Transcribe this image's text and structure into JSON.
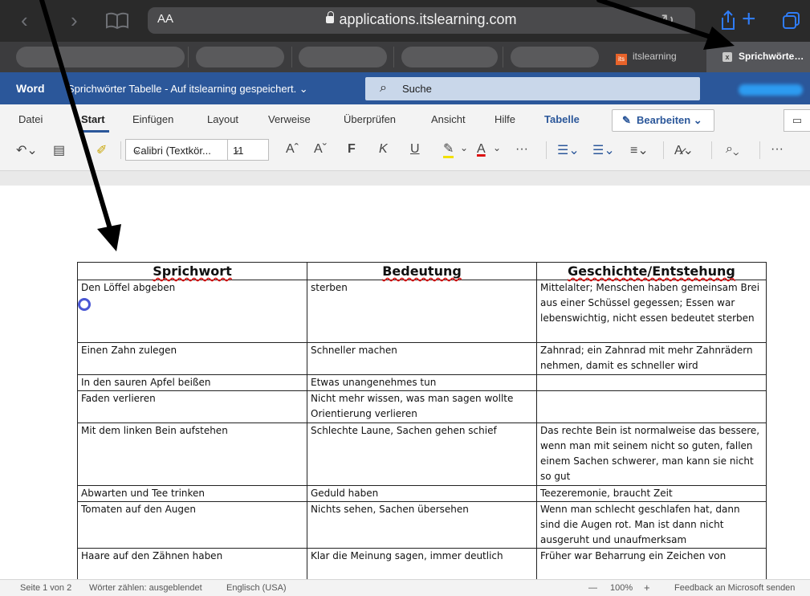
{
  "browser": {
    "text_size_label": "AA",
    "url": "applications.itslearning.com",
    "tabs": [
      {
        "label": "itslearning",
        "logo_text": "its"
      },
      {
        "label": "Sprichwörte…",
        "close_glyph": "x"
      }
    ]
  },
  "word": {
    "app_name": "Word",
    "doc_title": "Sprichwörter Tabelle - Auf itslearning gespeichert. ⌄",
    "search_placeholder": "Suche",
    "accent_color": "#2b579a"
  },
  "ribbon": {
    "menu": [
      "Datei",
      "Start",
      "Einfügen",
      "Layout",
      "Verweise",
      "Überprüfen",
      "Ansicht",
      "Hilfe",
      "Tabelle"
    ],
    "edit_button": "Bearbeiten ⌄",
    "font_name": "Calibri (Textkör...",
    "font_size": "11",
    "grow_font": "Aˆ",
    "shrink_font": "Aˇ",
    "bold": "F",
    "italic": "K",
    "underline": "U",
    "more": "···"
  },
  "table": {
    "headers": [
      "Sprichwort",
      "Bedeutung",
      "Geschichte/Entstehung"
    ],
    "rows": [
      [
        "Den Löffel abgeben",
        "sterben",
        "Mittelalter; Menschen haben gemeinsam Brei aus einer Schüssel gegessen; Essen war lebenswichtig, nicht essen bedeutet sterben"
      ],
      [
        "Einen Zahn zulegen",
        "Schneller machen",
        "Zahnrad; ein Zahnrad mit mehr Zahnrädern nehmen, damit es schneller wird"
      ],
      [
        "In den sauren Apfel beißen",
        "Etwas unangenehmes tun",
        ""
      ],
      [
        "Faden verlieren",
        "Nicht mehr wissen, was man sagen wollte Orientierung verlieren",
        ""
      ],
      [
        "Mit dem linken Bein aufstehen",
        "Schlechte Laune, Sachen gehen schief",
        "Das rechte Bein ist normalweise das bessere, wenn man mit seinem nicht so guten, fallen einem Sachen schwerer, man kann sie nicht so gut"
      ],
      [
        "Abwarten und Tee trinken",
        "Geduld haben",
        "Teezeremonie, braucht Zeit"
      ],
      [
        "Tomaten auf den Augen",
        "Nichts sehen, Sachen übersehen",
        "Wenn man schlecht geschlafen hat, dann sind die Augen rot. Man ist dann nicht ausgeruht und unaufmerksam"
      ],
      [
        "Haare auf den Zähnen haben",
        "Klar die Meinung sagen, immer deutlich",
        "Früher war Beharrung ein Zeichen von"
      ]
    ]
  },
  "status": {
    "page": "Seite 1 von 2",
    "words": "Wörter zählen: ausgeblendet",
    "language": "Englisch (USA)",
    "zoom_minus": "—",
    "zoom": "100%",
    "zoom_plus": "+",
    "feedback": "Feedback an Microsoft senden"
  }
}
